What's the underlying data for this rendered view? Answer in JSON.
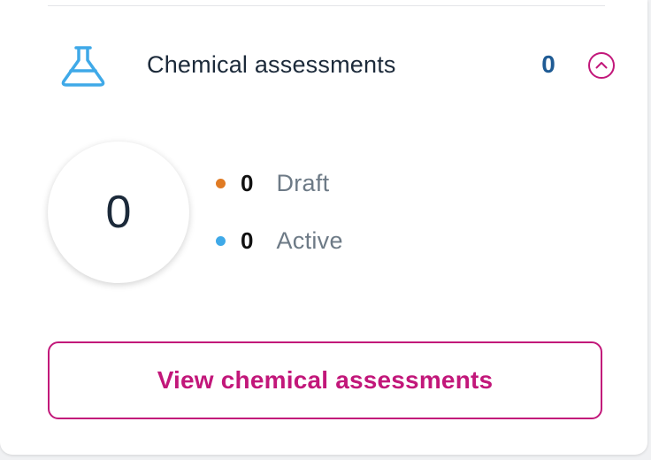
{
  "section": {
    "title": "Chemical assessments",
    "count": "0",
    "icon": "flask-icon",
    "collapse_icon": "chevron-up-icon"
  },
  "summary": {
    "total": "0",
    "statuses": [
      {
        "count": "0",
        "label": "Draft",
        "color": "#e07b24"
      },
      {
        "count": "0",
        "label": "Active",
        "color": "#3fa9e8"
      }
    ]
  },
  "action": {
    "label": "View chemical assessments"
  },
  "colors": {
    "accent": "#c2177a",
    "count": "#1f5b94",
    "icon": "#3fa9e8"
  }
}
